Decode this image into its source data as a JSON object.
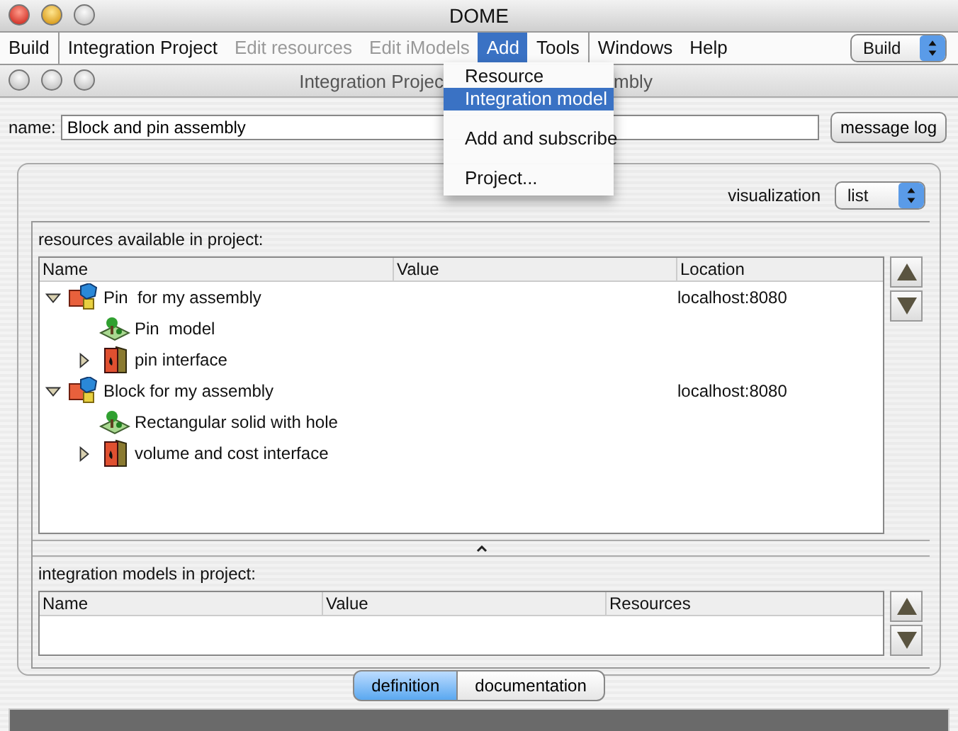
{
  "window": {
    "title": "DOME"
  },
  "menu_bar": [
    {
      "label": "Build",
      "disabled": false,
      "selected": false,
      "divider_after": true
    },
    {
      "label": "Integration Project",
      "disabled": false,
      "selected": false,
      "divider_after": false
    },
    {
      "label": "Edit resources",
      "disabled": true,
      "selected": false,
      "divider_after": false
    },
    {
      "label": "Edit iModels",
      "disabled": true,
      "selected": false,
      "divider_after": false
    },
    {
      "label": "Add",
      "disabled": false,
      "selected": true,
      "divider_after": false
    },
    {
      "label": "Tools",
      "disabled": false,
      "selected": false,
      "divider_after": true
    },
    {
      "label": "Windows",
      "disabled": false,
      "selected": false,
      "divider_after": false
    },
    {
      "label": "Help",
      "disabled": false,
      "selected": false,
      "divider_after": false
    }
  ],
  "mode_select": {
    "value": "Build"
  },
  "add_menu": [
    {
      "kind": "item",
      "label": "Resource",
      "selected": false
    },
    {
      "kind": "item",
      "label": "Integration model",
      "selected": true
    },
    {
      "kind": "separator"
    },
    {
      "kind": "item",
      "label": "Add and subscribe",
      "selected": false
    },
    {
      "kind": "separator"
    },
    {
      "kind": "item",
      "label": "Project...",
      "selected": false
    }
  ],
  "project_window": {
    "title_parts": [
      "Integration Projec",
      "mbly"
    ]
  },
  "name_field": {
    "label": "name:",
    "value": "Block and pin assembly"
  },
  "message_log_button": "message log",
  "visualization": {
    "label": "visualization",
    "value": "list"
  },
  "resources": {
    "title": "resources available in project:",
    "columns": [
      "Name",
      "Value",
      "Location"
    ],
    "rows": [
      {
        "name": "Pin  for my assembly",
        "kind": "project",
        "expanded": true,
        "location": "localhost:8080",
        "children": [
          {
            "name": "Pin  model",
            "kind": "model"
          },
          {
            "name": "pin interface",
            "kind": "interface",
            "expanded": false
          }
        ]
      },
      {
        "name": "Block for my assembly",
        "kind": "project",
        "expanded": true,
        "location": "localhost:8080",
        "children": [
          {
            "name": "Rectangular solid with hole",
            "kind": "model"
          },
          {
            "name": "volume and cost interface",
            "kind": "interface",
            "expanded": false
          }
        ]
      }
    ]
  },
  "integration_models": {
    "title": "integration models in project:",
    "columns": [
      "Name",
      "Value",
      "Resources"
    ]
  },
  "tabs": [
    {
      "label": "definition",
      "selected": true
    },
    {
      "label": "documentation",
      "selected": false
    }
  ]
}
